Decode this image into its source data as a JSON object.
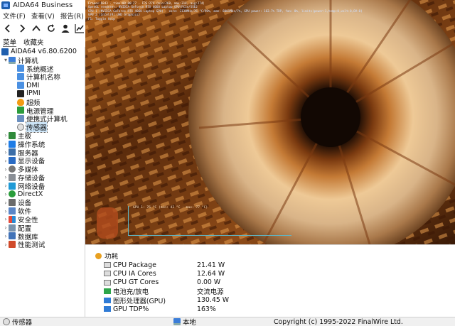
{
  "window": {
    "title": "AIDA64 Business"
  },
  "menu": [
    "文件(F)",
    "查看(V)",
    "报告(R)",
    "收"
  ],
  "toolbar": [
    {
      "name": "back-icon",
      "glyph": "‹"
    },
    {
      "name": "forward-icon",
      "glyph": "›"
    },
    {
      "name": "up-icon",
      "glyph": "⌃"
    },
    {
      "name": "refresh-icon",
      "glyph": "↻"
    },
    {
      "name": "user-icon",
      "glyph": "👤"
    },
    {
      "name": "chart-icon",
      "glyph": "📈"
    }
  ],
  "tabs": [
    "菜单",
    "收藏夹"
  ],
  "tree": {
    "root": "AIDA64 v6.80.6200",
    "items": [
      {
        "label": "计算机",
        "level": 1,
        "expander": "▾",
        "icon": "i-pc"
      },
      {
        "label": "系统概述",
        "level": 2,
        "icon": "i-doc"
      },
      {
        "label": "计算机名称",
        "level": 2,
        "icon": "i-doc"
      },
      {
        "label": "DMI",
        "level": 2,
        "icon": "i-doc"
      },
      {
        "label": "IPMI",
        "level": 2,
        "icon": "i-ipmi"
      },
      {
        "label": "超频",
        "level": 2,
        "icon": "i-fire"
      },
      {
        "label": "电源管理",
        "level": 2,
        "icon": "i-power"
      },
      {
        "label": "便携式计算机",
        "level": 2,
        "icon": "i-laptop"
      },
      {
        "label": "传感器",
        "level": 2,
        "icon": "i-sensor",
        "selected": true
      },
      {
        "label": "主板",
        "level": 1,
        "expander": "›",
        "icon": "i-board"
      },
      {
        "label": "操作系统",
        "level": 1,
        "expander": "›",
        "icon": "i-win"
      },
      {
        "label": "服务器",
        "level": 1,
        "expander": "›",
        "icon": "i-server"
      },
      {
        "label": "显示设备",
        "level": 1,
        "expander": "›",
        "icon": "i-display"
      },
      {
        "label": "多媒体",
        "level": 1,
        "expander": "›",
        "icon": "i-media"
      },
      {
        "label": "存储设备",
        "level": 1,
        "expander": "›",
        "icon": "i-storage"
      },
      {
        "label": "网络设备",
        "level": 1,
        "expander": "›",
        "icon": "i-net"
      },
      {
        "label": "DirectX",
        "level": 1,
        "expander": "›",
        "icon": "i-dx"
      },
      {
        "label": "设备",
        "level": 1,
        "expander": "›",
        "icon": "i-dev"
      },
      {
        "label": "软件",
        "level": 1,
        "expander": "›",
        "icon": "i-soft"
      },
      {
        "label": "安全性",
        "level": 1,
        "expander": "›",
        "icon": "i-sec"
      },
      {
        "label": "配置",
        "level": 1,
        "expander": "›",
        "icon": "i-cfg"
      },
      {
        "label": "数据库",
        "level": 1,
        "expander": "›",
        "icon": "i-db"
      },
      {
        "label": "性能测试",
        "level": 1,
        "expander": "›",
        "icon": "i-bench"
      }
    ]
  },
  "render_overlay": {
    "header": "Frames:6843 · time:00:00:27 · FPS:274 (min:260, max:318, avg:274)",
    "lines": [
      "OpenGL renderer: NVIDIA GeForce RTX 4060 Laptop GPU/PCIe/SSE2",
      "GPU 1 (NVIDIA GeForce RTX 4060 Laptop GPU) - core: 2130MHz/76 °C/90%, mem: 8001MHz/7%, GPU power: 162.7% TDP, fan: 0%, limits(power:1,temp:0,volt:0,OV:0)",
      "GPU 2 (Intel(R) UHD Graphics)",
      "F1: Toggle help"
    ],
    "gpu_graph_label": "GPU 1: 76 °C (min: 42 °C - max: 77 °C)"
  },
  "details": {
    "section": "功耗",
    "rows": [
      {
        "name": "CPU Package",
        "value": "21.41 W",
        "icon": "m-chip"
      },
      {
        "name": "CPU IA Cores",
        "value": "12.64 W",
        "icon": "m-chip"
      },
      {
        "name": "CPU GT Cores",
        "value": "0.00 W",
        "icon": "m-chip"
      },
      {
        "name": "电池充/放电",
        "value": "交流电源",
        "icon": "m-bat"
      },
      {
        "name": "图形处理器(GPU)",
        "value": "130.45 W",
        "icon": "m-gpu"
      },
      {
        "name": "GPU TDP%",
        "value": "163%",
        "icon": "m-gpu"
      }
    ]
  },
  "statusbar": {
    "left": "传感器",
    "middle": "本地",
    "right": "Copyright (c) 1995-2022 FinalWire Ltd."
  },
  "colors": {
    "selection": "#cce4f7",
    "graph_axis": "#5fb6c6"
  }
}
